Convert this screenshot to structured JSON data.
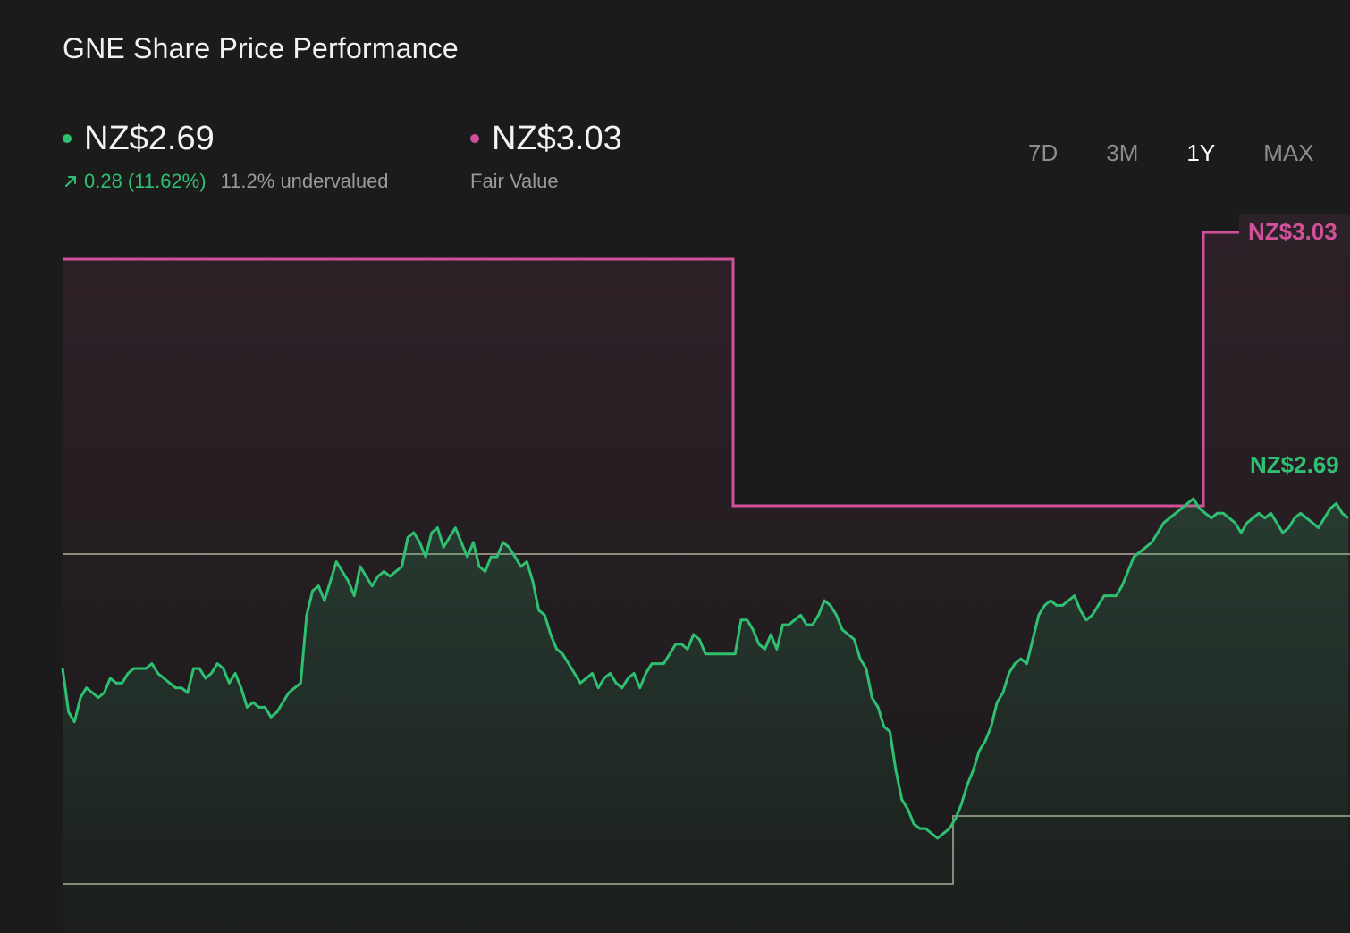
{
  "title": "GNE Share Price Performance",
  "price": {
    "value": "NZ$2.69",
    "change": "0.28 (11.62%)",
    "valuation_note": "11.2% undervalued",
    "color": "#2fbf71"
  },
  "fair_value": {
    "value": "NZ$3.03",
    "label": "Fair Value",
    "color": "#d1509a"
  },
  "ranges": [
    "7D",
    "3M",
    "1Y",
    "MAX"
  ],
  "active_range": "1Y",
  "chart_data": {
    "type": "line",
    "x_range": [
      0,
      1
    ],
    "y_range_px_note": "",
    "series": [
      {
        "name": "",
        "color": "#2fbf71",
        "values": [
          2.38,
          2.29,
          2.27,
          2.32,
          2.34,
          2.33,
          2.32,
          2.33,
          2.36,
          2.35,
          2.35,
          2.37,
          2.38,
          2.38,
          2.38,
          2.39,
          2.37,
          2.36,
          2.35,
          2.34,
          2.34,
          2.33,
          2.38,
          2.38,
          2.36,
          2.37,
          2.39,
          2.38,
          2.35,
          2.37,
          2.34,
          2.3,
          2.31,
          2.3,
          2.3,
          2.28,
          2.29,
          2.31,
          2.33,
          2.34,
          2.35,
          2.49,
          2.54,
          2.55,
          2.52,
          2.56,
          2.6,
          2.58,
          2.56,
          2.53,
          2.59,
          2.57,
          2.55,
          2.57,
          2.58,
          2.57,
          2.58,
          2.59,
          2.65,
          2.66,
          2.64,
          2.61,
          2.66,
          2.67,
          2.63,
          2.65,
          2.67,
          2.64,
          2.61,
          2.64,
          2.59,
          2.58,
          2.61,
          2.61,
          2.64,
          2.63,
          2.61,
          2.59,
          2.6,
          2.56,
          2.5,
          2.49,
          2.45,
          2.42,
          2.41,
          2.39,
          2.37,
          2.35,
          2.36,
          2.37,
          2.34,
          2.36,
          2.37,
          2.35,
          2.34,
          2.36,
          2.37,
          2.34,
          2.37,
          2.39,
          2.39,
          2.39,
          2.41,
          2.43,
          2.43,
          2.42,
          2.45,
          2.44,
          2.41,
          2.41,
          2.41,
          2.41,
          2.41,
          2.41,
          2.48,
          2.48,
          2.46,
          2.43,
          2.42,
          2.45,
          2.42,
          2.47,
          2.47,
          2.48,
          2.49,
          2.47,
          2.47,
          2.49,
          2.52,
          2.51,
          2.49,
          2.46,
          2.45,
          2.44,
          2.4,
          2.38,
          2.32,
          2.3,
          2.26,
          2.25,
          2.17,
          2.11,
          2.09,
          2.06,
          2.05,
          2.05,
          2.04,
          2.03,
          2.04,
          2.05,
          2.07,
          2.1,
          2.14,
          2.17,
          2.21,
          2.23,
          2.26,
          2.31,
          2.33,
          2.37,
          2.39,
          2.4,
          2.39,
          2.44,
          2.49,
          2.51,
          2.52,
          2.51,
          2.51,
          2.52,
          2.53,
          2.5,
          2.48,
          2.49,
          2.51,
          2.53,
          2.53,
          2.53,
          2.55,
          2.58,
          2.61,
          2.62,
          2.63,
          2.64,
          2.66,
          2.68,
          2.69,
          2.7,
          2.71,
          2.72,
          2.73,
          2.71,
          2.7,
          2.69,
          2.7,
          2.7,
          2.69,
          2.68,
          2.66,
          2.68,
          2.69,
          2.7,
          2.69,
          2.7,
          2.68,
          2.66,
          2.67,
          2.69,
          2.7,
          2.69,
          2.68,
          2.67,
          2.69,
          2.71,
          2.72,
          2.7,
          2.69
        ]
      }
    ],
    "labels": {
      "price": "NZ$2.69",
      "fair_value": "NZ$3.03"
    }
  }
}
